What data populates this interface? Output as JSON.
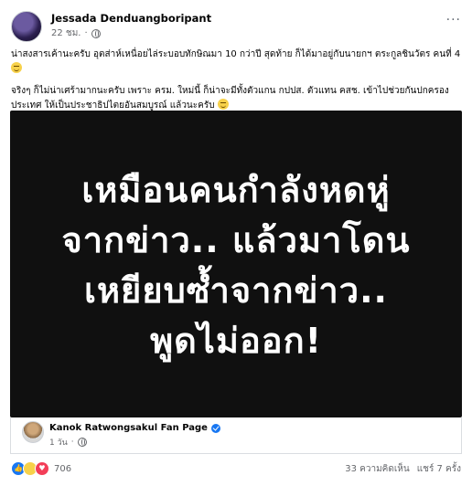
{
  "post": {
    "author": "Jessada Denduangboripant",
    "time": "22 ชม.",
    "privacy_icon": "globe-icon",
    "more_label": "···",
    "paragraph1": "น่าสงสารเค้านะครับ อุตส่าห์เหนื่อยไล่ระบอบทักษิณมา 10 กว่าปี สุดท้าย ก็ได้มาอยู่กับนายกฯ ตระกูลชินวัตร คนที่ 4",
    "paragraph2": "จริงๆ ก็ไม่น่าเศร้ามากนะครับ เพราะ ครม. ใหม่นี้ ก็น่าจะมีทั้งตัวแกน กปปส. ตัวแทน คสช. เข้าไปช่วยกันปกครองประเทศ ให้เป็นประชาธิปไตยอันสมบูรณ์ แล้วนะครับ"
  },
  "shared": {
    "quote_line1": "เหมือนคนกำลังหดหู่",
    "quote_line2": "จากข่าว.. แล้วมาโดน",
    "quote_line3": "เหยียบซ้ำจากข่าว..",
    "quote_line4": "พูดไม่ออก!",
    "page_name": "Kanok Ratwongsakul Fan Page",
    "time": "1 วัน"
  },
  "footer": {
    "reaction_count": "706",
    "comments": "33 ความคิดเห็น",
    "shares": "แชร์ 7 ครั้ง"
  },
  "colors": {
    "brand_blue": "#1877f2",
    "media_bg": "#101010"
  }
}
